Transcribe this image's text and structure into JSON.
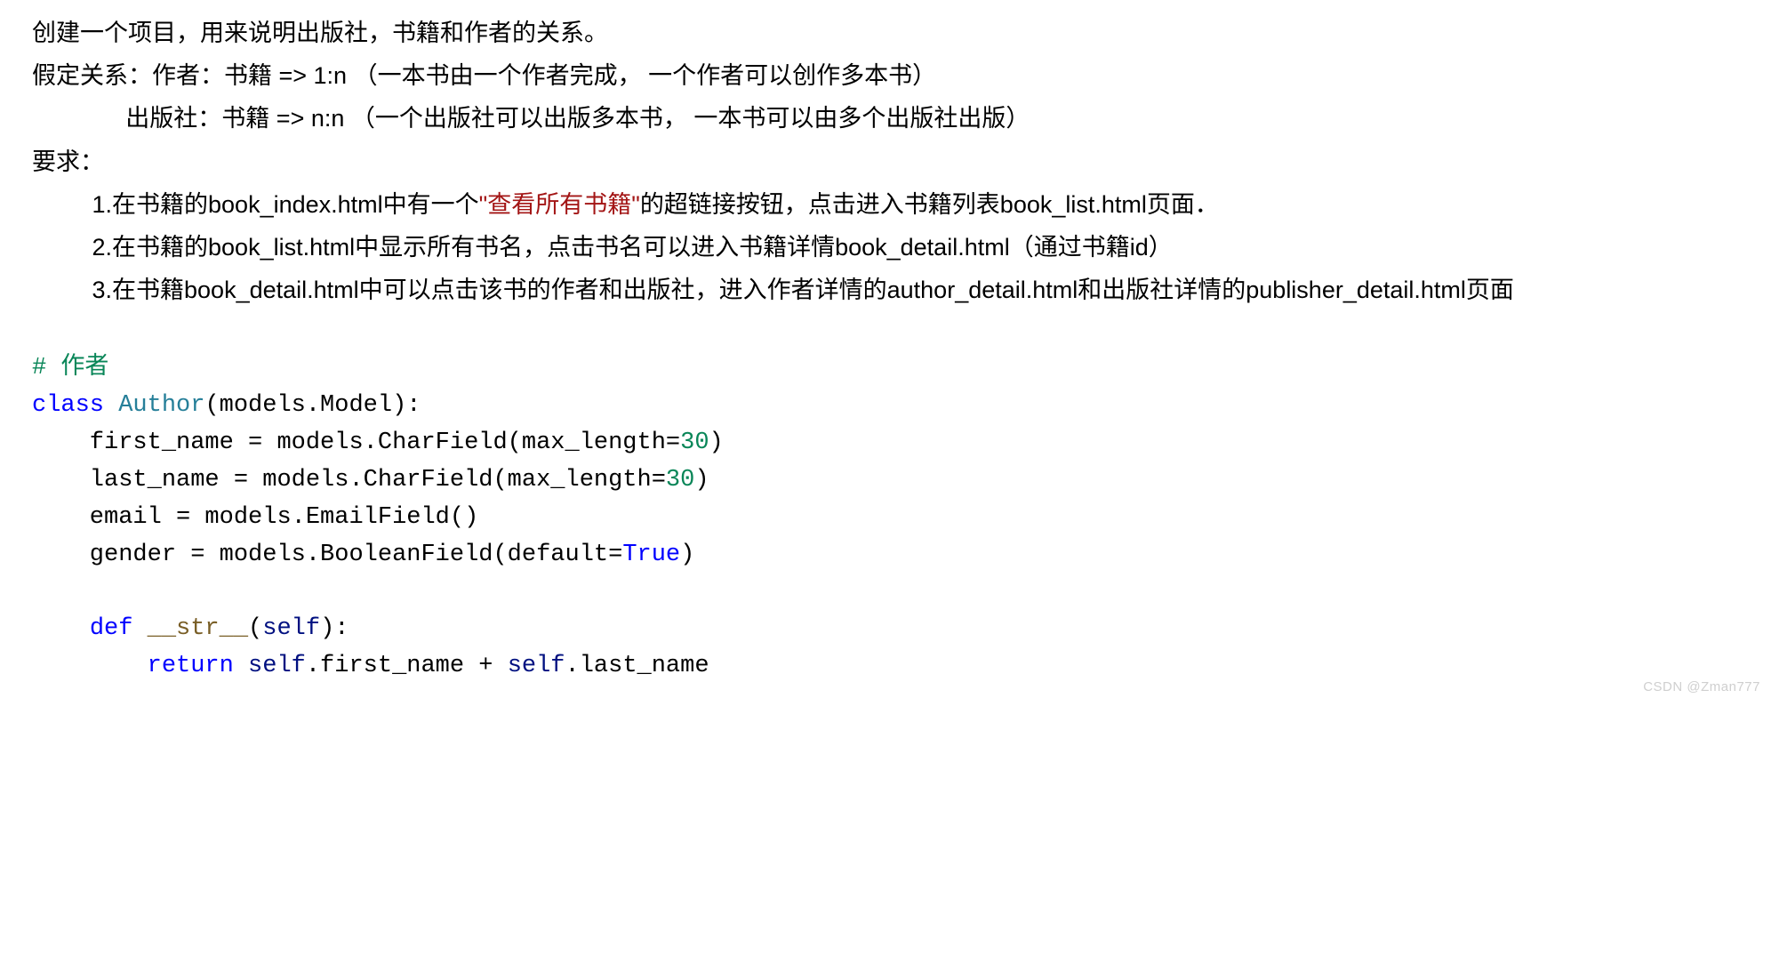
{
  "intro": {
    "title": "创建一个项目，用来说明出版社，书籍和作者的关系。",
    "relation_author": "假定关系：作者：书籍 => 1:n    （一本书由一个作者完成，  一个作者可以创作多本书）",
    "relation_publisher": "出版社：书籍 => n:n    （一个出版社可以出版多本书，  一本书可以由多个出版社出版）",
    "req_label": "要求：",
    "req1_pre": "1.在书籍的book_index.html中有一个",
    "req1_hi": "\"查看所有书籍\"",
    "req1_post": "的超链接按钮，点击进入书籍列表book_list.html页面．",
    "req2": "2.在书籍的book_list.html中显示所有书名，点击书名可以进入书籍详情book_detail.html（通过书籍id）",
    "req3": "3.在书籍book_detail.html中可以点击该书的作者和出版社，进入作者详情的author_detail.html和出版社详情的publisher_detail.html页面"
  },
  "code": {
    "c1": "# 作者",
    "c2_kw": "class",
    "c2_cls": "Author",
    "c2_rest": "(models.Model):",
    "c3": "    first_name = models.CharField(max_length=",
    "c3_n": "30",
    "c3_e": ")",
    "c4": "    last_name = models.CharField(max_length=",
    "c4_n": "30",
    "c4_e": ")",
    "c5": "    email = models.EmailField()",
    "c6": "    gender = models.BooleanField(default=",
    "c6_b": "True",
    "c6_e": ")",
    "c7_kw": "def",
    "c7_fn": "__str__",
    "c7_rest": "(",
    "c7_self": "self",
    "c7_end": "):",
    "c8_kw": "return",
    "c8_a": "self",
    "c8_b": ".first_name + ",
    "c8_c": "self",
    "c8_d": ".last_name"
  },
  "watermark": "CSDN @Zman777"
}
